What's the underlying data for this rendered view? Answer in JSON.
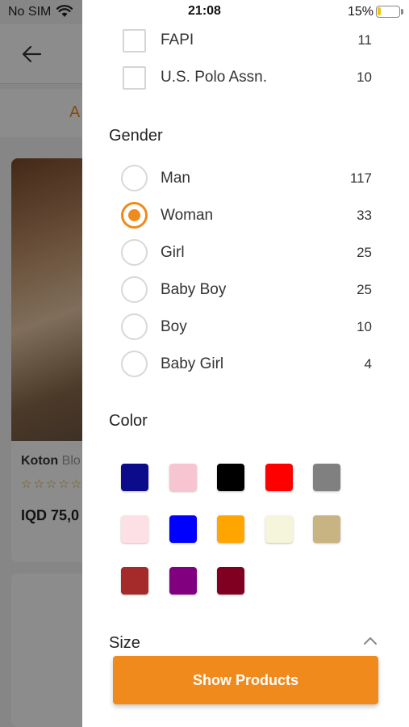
{
  "status_bar": {
    "carrier": "No SIM",
    "time": "21:08",
    "battery": "15%",
    "battery_level": 0.15
  },
  "background": {
    "tab_text": "A",
    "card": {
      "brand": "Koton",
      "subtitle": "Blo",
      "stars": "☆☆☆☆☆",
      "price": "IQD 75,0"
    }
  },
  "brand_filter": {
    "items": [
      {
        "label": "FAPI",
        "count": "11"
      },
      {
        "label": "U.S. Polo Assn.",
        "count": "10"
      }
    ]
  },
  "gender": {
    "title": "Gender",
    "items": [
      {
        "label": "Man",
        "count": "117",
        "selected": false
      },
      {
        "label": "Woman",
        "count": "33",
        "selected": true
      },
      {
        "label": "Girl",
        "count": "25",
        "selected": false
      },
      {
        "label": "Baby Boy",
        "count": "25",
        "selected": false
      },
      {
        "label": "Boy",
        "count": "10",
        "selected": false
      },
      {
        "label": "Baby Girl",
        "count": "4",
        "selected": false
      }
    ]
  },
  "color": {
    "title": "Color",
    "swatches": [
      "#0b0b8c",
      "#f7c4d2",
      "#000000",
      "#ff0000",
      "#808080",
      "#fde0e6",
      "#0000ff",
      "#ffa500",
      "#f5f5dc",
      "#c8b482",
      "#a52a2a",
      "#800080",
      "#7f0020"
    ]
  },
  "size": {
    "title": "Size",
    "icon": "chevron-up-icon"
  },
  "footer": {
    "show_products_label": "Show Products"
  },
  "accent_color": "#f08a1c"
}
